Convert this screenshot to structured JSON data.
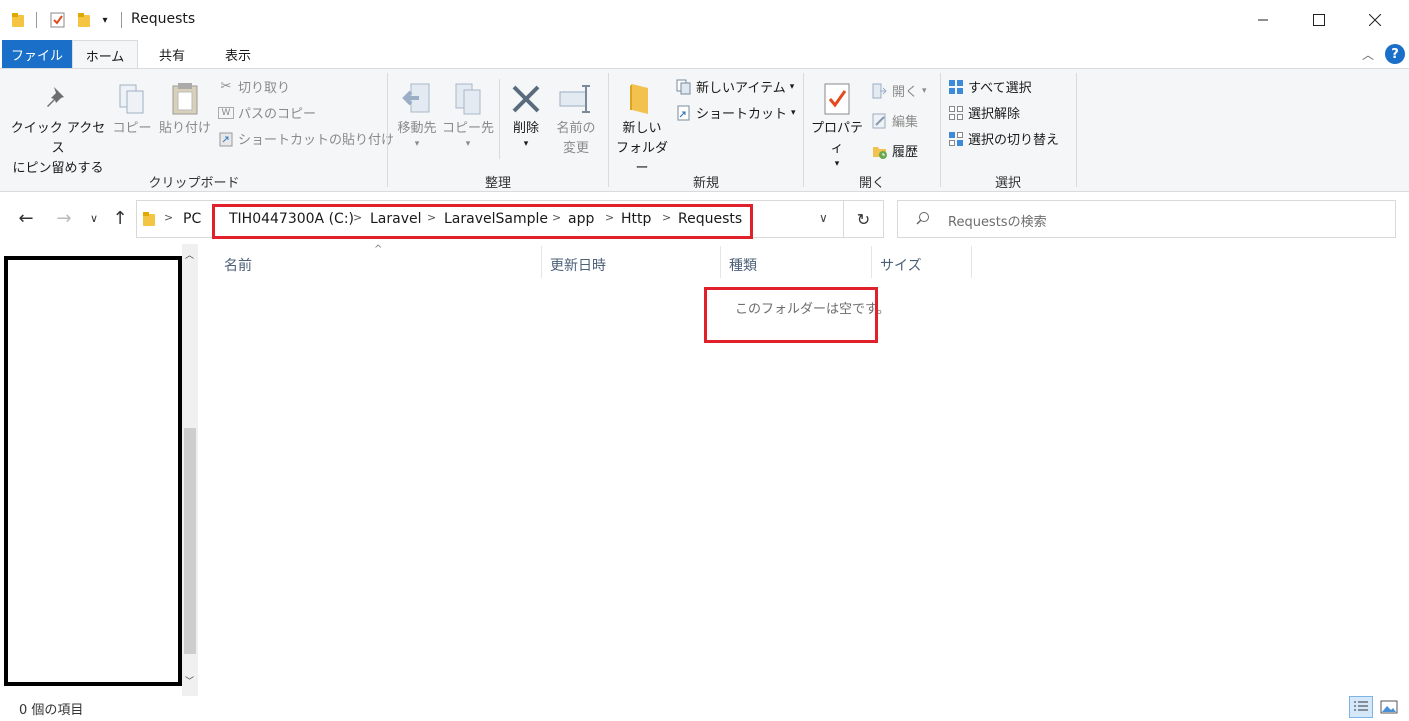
{
  "window": {
    "title": "Requests",
    "minimize_icon": "minimize-icon",
    "maximize_icon": "maximize-icon",
    "close_icon": "close-icon"
  },
  "tabs": [
    {
      "label": "ファイル"
    },
    {
      "label": "ホーム"
    },
    {
      "label": "共有"
    },
    {
      "label": "表示"
    }
  ],
  "ribbon": {
    "clipboard": {
      "pin_label_1": "クイック アクセス",
      "pin_label_2": "にピン留めする",
      "copy": "コピー",
      "paste": "貼り付け",
      "cut": "切り取り",
      "copy_path": "パスのコピー",
      "paste_shortcut": "ショートカットの貼り付け",
      "group": "クリップボード"
    },
    "organize": {
      "move_to": "移動先",
      "copy_to": "コピー先",
      "delete": "削除",
      "rename_1": "名前の",
      "rename_2": "変更",
      "group": "整理"
    },
    "new": {
      "new_folder_1": "新しい",
      "new_folder_2": "フォルダー",
      "new_item": "新しいアイテム",
      "shortcut": "ショートカット",
      "group": "新規"
    },
    "open": {
      "properties": "プロパティ",
      "open": "開く",
      "edit": "編集",
      "history": "履歴",
      "group": "開く"
    },
    "select": {
      "select_all": "すべて選択",
      "select_none": "選択解除",
      "invert": "選択の切り替え",
      "group": "選択"
    }
  },
  "address": {
    "crumbs": [
      "PC",
      "TIH0447300A (C:)",
      "Laravel",
      "LaravelSample",
      "app",
      "Http",
      "Requests"
    ]
  },
  "search": {
    "placeholder": "Requestsの検索"
  },
  "columns": [
    "名前",
    "更新日時",
    "種類",
    "サイズ"
  ],
  "empty_message": "このフォルダーは空です。",
  "status": {
    "item_count": "0 個の項目"
  },
  "colors": {
    "file_tab": "#1a6fc9",
    "highlight": "#e0202a"
  }
}
